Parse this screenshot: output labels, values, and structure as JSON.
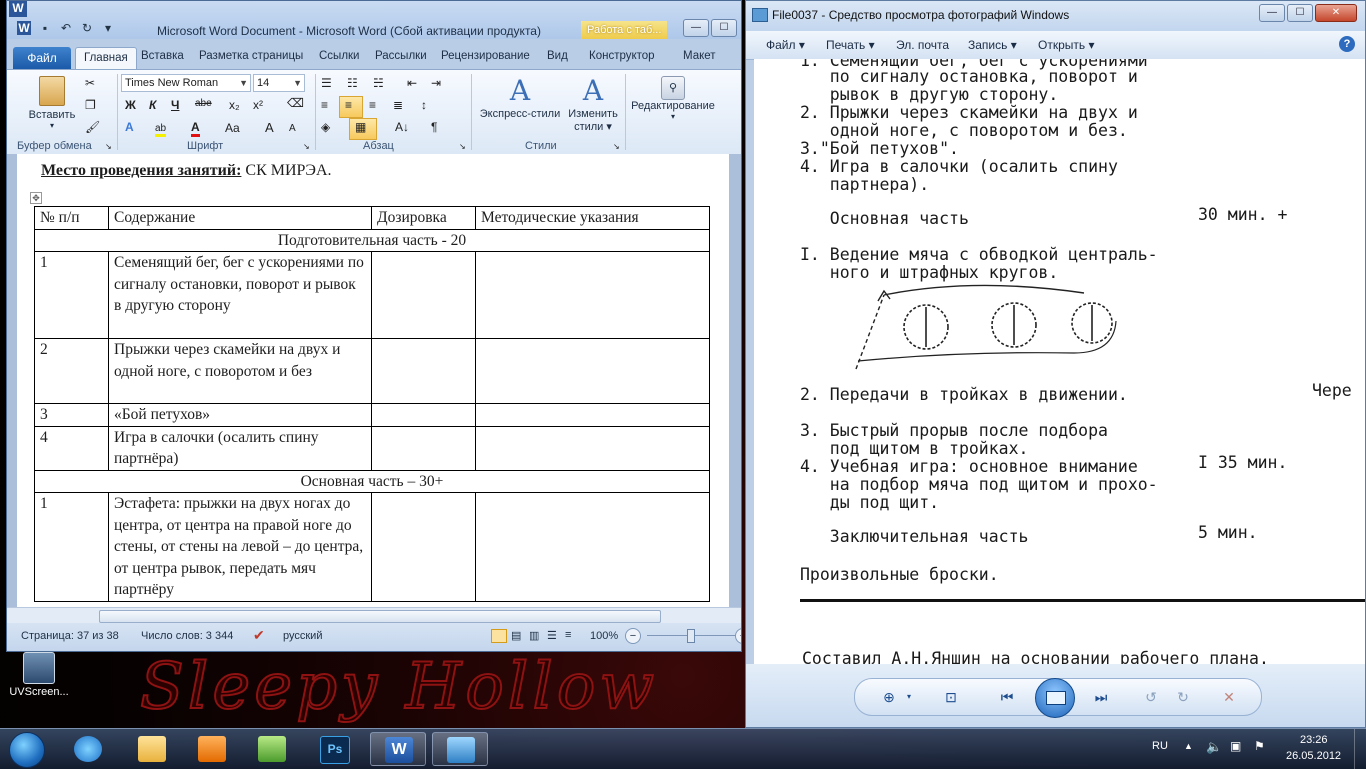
{
  "colors": {
    "word_blue": "#1b5aa8",
    "ctx_yellow": "#eecb4a",
    "wallpaper_red": "#8e1212"
  },
  "desktop": {
    "wallpaper_text": "Sleepy Hollow",
    "icon_label": "UVScreen..."
  },
  "word": {
    "title": "Microsoft Word Document  -  Microsoft Word (Сбой активации продукта)",
    "context_tab": "Работа с таб...",
    "tabs": {
      "file": "Файл",
      "home": "Главная",
      "insert": "Вставка",
      "layout": "Разметка страницы",
      "refs": "Ссылки",
      "mailings": "Рассылки",
      "review": "Рецензирование",
      "view": "Вид",
      "design": "Конструктор",
      "table_layout": "Макет"
    },
    "ribbon": {
      "paste": "Вставить",
      "font_name": "Times New Roman",
      "font_size": "14",
      "express_styles": "Экспресс-стили",
      "change_styles_1": "Изменить",
      "change_styles_2": "стили",
      "editing": "Редактирование",
      "groups": {
        "clipboard": "Буфер обмена",
        "font": "Шрифт",
        "paragraph": "Абзац",
        "styles": "Стили"
      },
      "fmt": {
        "bold": "Ж",
        "italic": "К",
        "underline": "Ч",
        "strike": "abe",
        "sub": "x₂",
        "sup": "x²",
        "grow": "A",
        "shrink": "A",
        "case": "Aa",
        "pilcrow": "¶",
        "sort": "A↓"
      }
    },
    "doc": {
      "place_label": "Место проведения занятий:",
      "place_value": " СК МИРЭА.",
      "headers": [
        "№ п/п",
        "Содержание",
        "Дозировка",
        "Методические указания"
      ],
      "section1": "Подготовительная часть - 20",
      "rows1": [
        {
          "n": "1",
          "text": "Семенящий бег, бег с ускорениями по сигналу остановки, поворот и рывок в другую сторону"
        },
        {
          "n": "2",
          "text": "Прыжки через скамейки на двух и одной ноге, с поворотом и без"
        },
        {
          "n": "3",
          "text": "«Бой петухов»"
        },
        {
          "n": "4",
          "text": "Игра в салочки (осалить спину партнёра)"
        }
      ],
      "section2": "Основная часть – 30+",
      "rows2": [
        {
          "n": "1",
          "text": "Эстафета: прыжки на двух ногах до центра, от центра на правой ноге до стены, от стены на левой – до центра, от центра рывок, передать мяч партнёру"
        }
      ]
    },
    "status": {
      "page": "Страница: 37 из 38",
      "words": "Число слов: 3 344",
      "lang": "русский",
      "zoom": "100%",
      "minus": "−",
      "plus": "+"
    }
  },
  "viewer": {
    "title": "File0037 - Средство просмотра фотографий Windows",
    "menu": {
      "file": "Файл",
      "print": "Печать",
      "email": "Эл. почта",
      "burn": "Запись",
      "open": "Открыть",
      "help": "?"
    },
    "lines": [
      "1. Семенящий бег, бег с ускорениями",
      "   по сигналу остановка, поворот и",
      "   рывок в другую сторону.",
      "2. Прыжки через скамейки на двух и",
      "   одной ноге, с поворотом и без.",
      "3.\"Бой петухов\".",
      "4. Игра в салочки (осалить спину",
      "   партнера).",
      "   Основная часть",
      "30 мин. +",
      "I. Ведение мяча с обводкой централь-",
      "   ного и штрафных кругов.",
      "2. Передачи в тройках в движении.",
      "Чере",
      "3. Быстрый прорыв после подбора",
      "   под щитом в тройках.",
      "4. Учебная игра: основное внимание",
      "   на подбор мяча под щитом и прохо-",
      "   ды под щит.",
      "I 35 мин.",
      "   Заключительная часть",
      "5 мин.",
      "Произвольные броски.",
      "Составил А.Н.Яншин на основании рабочего плана."
    ]
  },
  "taskbar": {
    "lang": "RU",
    "time": "23:26",
    "date": "26.05.2012"
  }
}
